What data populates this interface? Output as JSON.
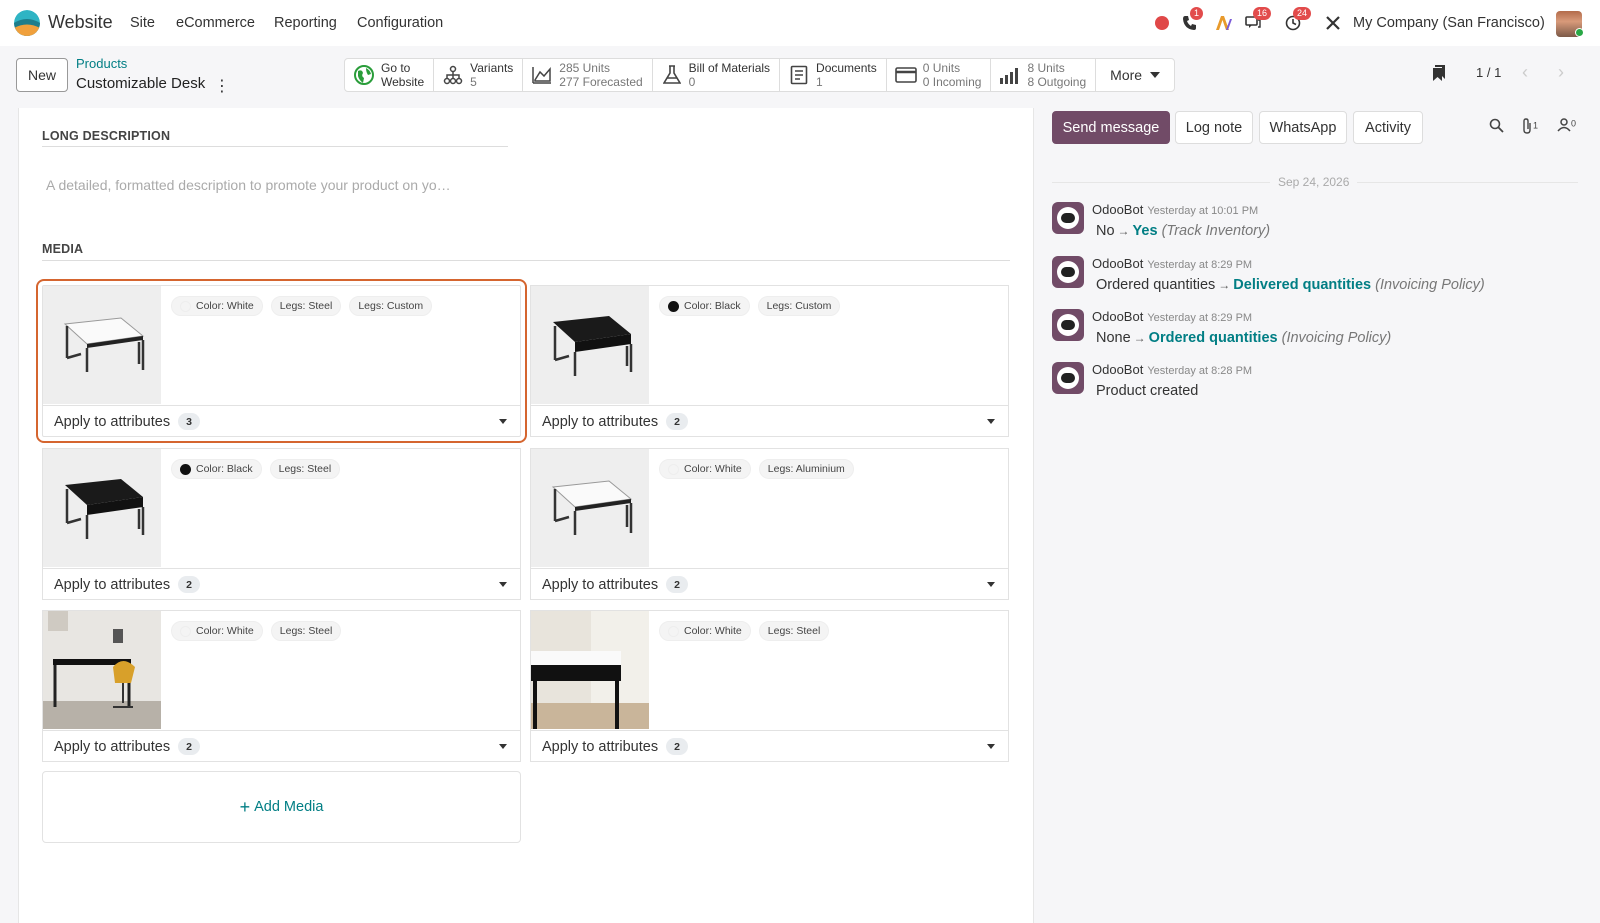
{
  "navbar": {
    "app_name": "Website",
    "menu": [
      "Site",
      "eCommerce",
      "Reporting",
      "Configuration"
    ],
    "badges": {
      "phone": "1",
      "discuss": "16",
      "activity": "24"
    },
    "company": "My Company (San Francisco)"
  },
  "control": {
    "new_label": "New",
    "breadcrumb": "Products",
    "record_name": "Customizable Desk",
    "pager": "1 / 1"
  },
  "smart_buttons": [
    {
      "l1": "Go to",
      "l2": "Website",
      "icon": "globe-icon"
    },
    {
      "l1": "Variants",
      "l2": "5",
      "icon": "variants-icon"
    },
    {
      "l1": "285 Units",
      "l2": "277 Forecasted",
      "icon": "forecast-chart-icon"
    },
    {
      "l1": "Bill of Materials",
      "l2": "0",
      "icon": "flask-icon"
    },
    {
      "l1": "Documents",
      "l2": "1",
      "icon": "document-icon"
    },
    {
      "l1": "0 Units",
      "l2": "0 Incoming",
      "icon": "credit-card-icon"
    },
    {
      "l1": "8 Units",
      "l2": "8 Outgoing",
      "icon": "bar-signal-icon"
    }
  ],
  "more_label": "More",
  "form": {
    "long_description_title": "LONG DESCRIPTION",
    "long_description_placeholder": "A detailed, formatted description to promote your product on yo…",
    "media_title": "MEDIA",
    "apply_label": "Apply to attributes",
    "add_media_label": "Add Media",
    "media": [
      {
        "tags": [
          {
            "text": "Color: White",
            "swatch": "white"
          },
          {
            "text": "Legs: Steel"
          },
          {
            "text": "Legs: Custom"
          }
        ],
        "count": "3",
        "image": "white-desk"
      },
      {
        "tags": [
          {
            "text": "Color: Black",
            "swatch": "black"
          },
          {
            "text": "Legs: Custom"
          }
        ],
        "count": "2",
        "image": "black-desk"
      },
      {
        "tags": [
          {
            "text": "Color: Black",
            "swatch": "black"
          },
          {
            "text": "Legs: Steel"
          }
        ],
        "count": "2",
        "image": "black-desk"
      },
      {
        "tags": [
          {
            "text": "Color: White",
            "swatch": "white"
          },
          {
            "text": "Legs: Aluminium"
          }
        ],
        "count": "2",
        "image": "white-desk"
      },
      {
        "tags": [
          {
            "text": "Color: White",
            "swatch": "white"
          },
          {
            "text": "Legs: Steel"
          }
        ],
        "count": "2",
        "image": "office-scene"
      },
      {
        "tags": [
          {
            "text": "Color: White",
            "swatch": "white"
          },
          {
            "text": "Legs: Steel"
          }
        ],
        "count": "2",
        "image": "desk-closeup"
      }
    ]
  },
  "chatter": {
    "send_message": "Send message",
    "log_note": "Log note",
    "whatsapp": "WhatsApp",
    "activity": "Activity",
    "attachments_count": "1",
    "followers_count": "0",
    "date": "Sep 24, 2026",
    "messages": [
      {
        "author": "OdooBot",
        "time": "Yesterday at 10:01 PM",
        "old": "No",
        "new": "Yes",
        "field": "(Track Inventory)"
      },
      {
        "author": "OdooBot",
        "time": "Yesterday at 8:29 PM",
        "old": "Ordered quantities",
        "new": "Delivered quantities",
        "field": "(Invoicing Policy)"
      },
      {
        "author": "OdooBot",
        "time": "Yesterday at 8:29 PM",
        "old": "None",
        "new": "Ordered quantities",
        "field": "(Invoicing Policy)"
      },
      {
        "author": "OdooBot",
        "time": "Yesterday at 8:28 PM",
        "body": "Product created"
      }
    ]
  }
}
